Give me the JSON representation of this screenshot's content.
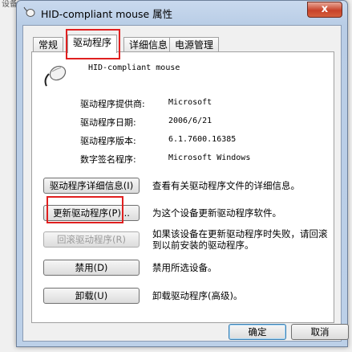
{
  "background": {
    "partial_text": "设备(D):"
  },
  "window": {
    "title": "HID-compliant mouse 属性",
    "close_label": "x"
  },
  "tabs": [
    {
      "label": "常规"
    },
    {
      "label": "驱动程序"
    },
    {
      "label": "详细信息"
    },
    {
      "label": "电源管理"
    }
  ],
  "device": {
    "name": "HID-compliant mouse",
    "icon": "mouse-icon"
  },
  "info": [
    {
      "label": "驱动程序提供商:",
      "value": "Microsoft"
    },
    {
      "label": "驱动程序日期:",
      "value": "2006/6/21"
    },
    {
      "label": "驱动程序版本:",
      "value": "6.1.7600.16385"
    },
    {
      "label": "数字签名程序:",
      "value": "Microsoft Windows"
    }
  ],
  "actions": [
    {
      "button": "驱动程序详细信息(I)",
      "desc": "查看有关驱动程序文件的详细信息。"
    },
    {
      "button": "更新驱动程序(P)...",
      "desc": "为这个设备更新驱动程序软件。"
    },
    {
      "button": "回滚驱动程序(R)",
      "desc": "如果该设备在更新驱动程序时失败，请回滚到以前安装的驱动程序。"
    },
    {
      "button": "禁用(D)",
      "desc": "禁用所选设备。"
    },
    {
      "button": "卸载(U)",
      "desc": "卸载驱动程序(高级)。"
    }
  ],
  "footer": {
    "ok": "确定",
    "cancel": "取消"
  },
  "colors": {
    "highlight": "#e02020",
    "title_bar": "#c9d9ee",
    "close_button": "#c7432a"
  }
}
